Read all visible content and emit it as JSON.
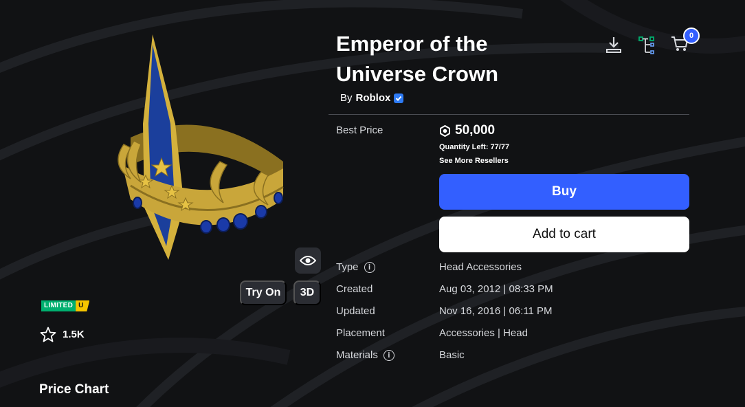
{
  "item": {
    "title": "Emperor of the Universe Crown",
    "by_prefix": "By",
    "creator": "Roblox",
    "favorites": "1.5K",
    "limited_label": "LIMITED",
    "limited_u": "U"
  },
  "header_icons": {
    "download_icon": "download-icon",
    "hierarchy_icon": "hierarchy-icon",
    "cart_icon": "cart-icon",
    "cart_count": "0"
  },
  "viewer": {
    "eye_icon": "eye-icon",
    "try_on_label": "Try On",
    "three_d_label": "3D"
  },
  "purchase": {
    "best_price_label": "Best Price",
    "price": "50,000",
    "currency_icon": "robux-icon",
    "quantity_left": "Quantity Left: 77/77",
    "see_more_resellers": "See More Resellers",
    "buy_label": "Buy",
    "add_to_cart_label": "Add to cart"
  },
  "details": [
    {
      "label": "Type",
      "value": "Head Accessories",
      "info": true
    },
    {
      "label": "Created",
      "value": "Aug 03, 2012 | 08:33 PM",
      "info": false
    },
    {
      "label": "Updated",
      "value": "Nov 16, 2016 | 06:11 PM",
      "info": false
    },
    {
      "label": "Placement",
      "value": "Accessories | Head",
      "info": false
    },
    {
      "label": "Materials",
      "value": "Basic",
      "info": true
    }
  ],
  "price_chart": {
    "title": "Price Chart"
  },
  "colors": {
    "background": "#111214",
    "accent_blue": "#335fff",
    "limited_green": "#00b06f",
    "limited_yellow": "#f6c500",
    "crown_gold": "#c9a63a",
    "crown_blue": "#1b3f9c"
  }
}
